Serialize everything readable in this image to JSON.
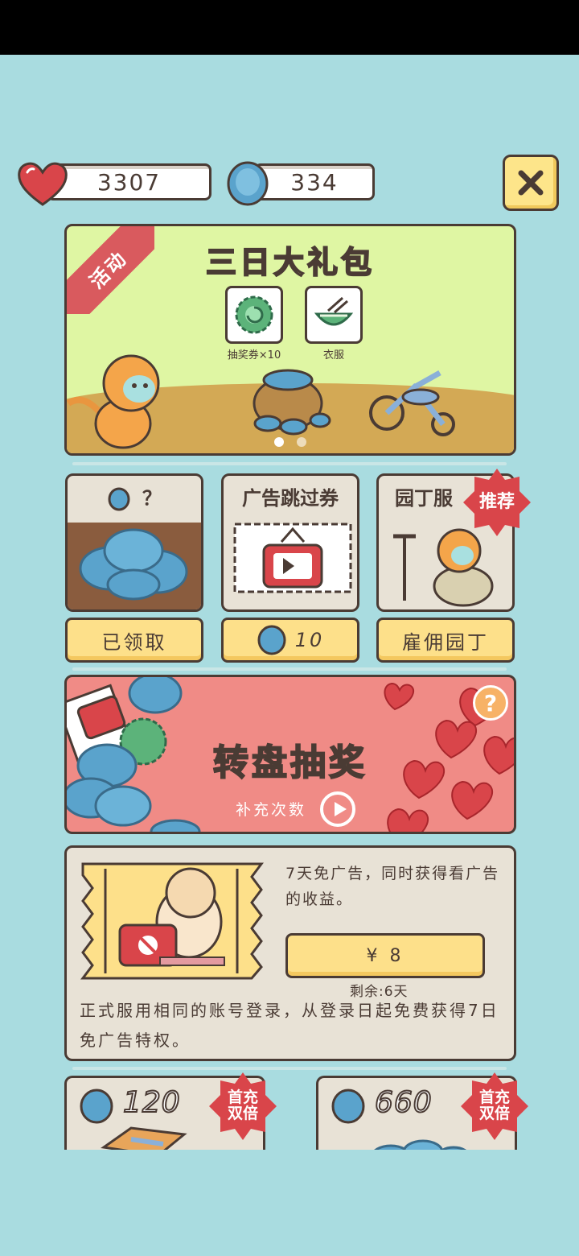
{
  "currency": {
    "hearts": "3307",
    "coins": "334",
    "close_label": "×"
  },
  "banner": {
    "tag": "活动",
    "title": "三日大礼包",
    "rewards": [
      {
        "icon": "lottery-ticket-icon",
        "label": "抽奖券×10"
      },
      {
        "icon": "outfit-icon",
        "label": "衣服"
      }
    ],
    "pages": 2,
    "current_page": 1
  },
  "cards": [
    {
      "title_icon": "coin-icon",
      "title": "？",
      "button": "已领取"
    },
    {
      "title": "广告跳过券",
      "button_value": "10"
    },
    {
      "title": "园丁服",
      "badge": "推荐",
      "button": "雇佣园丁"
    }
  ],
  "lottery": {
    "title": "转盘抽奖",
    "subtitle": "补充次数",
    "help": "?"
  },
  "noad": {
    "description": "7天免广告，同时获得看广告的收益。",
    "price": "¥ 8",
    "remaining": "剩余:6天",
    "footnote": "正式服用相同的账号登录，从登录日起免费获得7日免广告特权。"
  },
  "packs": [
    {
      "amount": "120",
      "badge": "首充双倍"
    },
    {
      "amount": "660",
      "badge": "首充双倍"
    }
  ],
  "colors": {
    "background": "#a9dce0",
    "banner": "#dff6a3",
    "button_yellow": "#fde08a",
    "badge_red": "#d9454a",
    "coin_blue": "#5aa3cc",
    "heart_red": "#d9454a"
  }
}
